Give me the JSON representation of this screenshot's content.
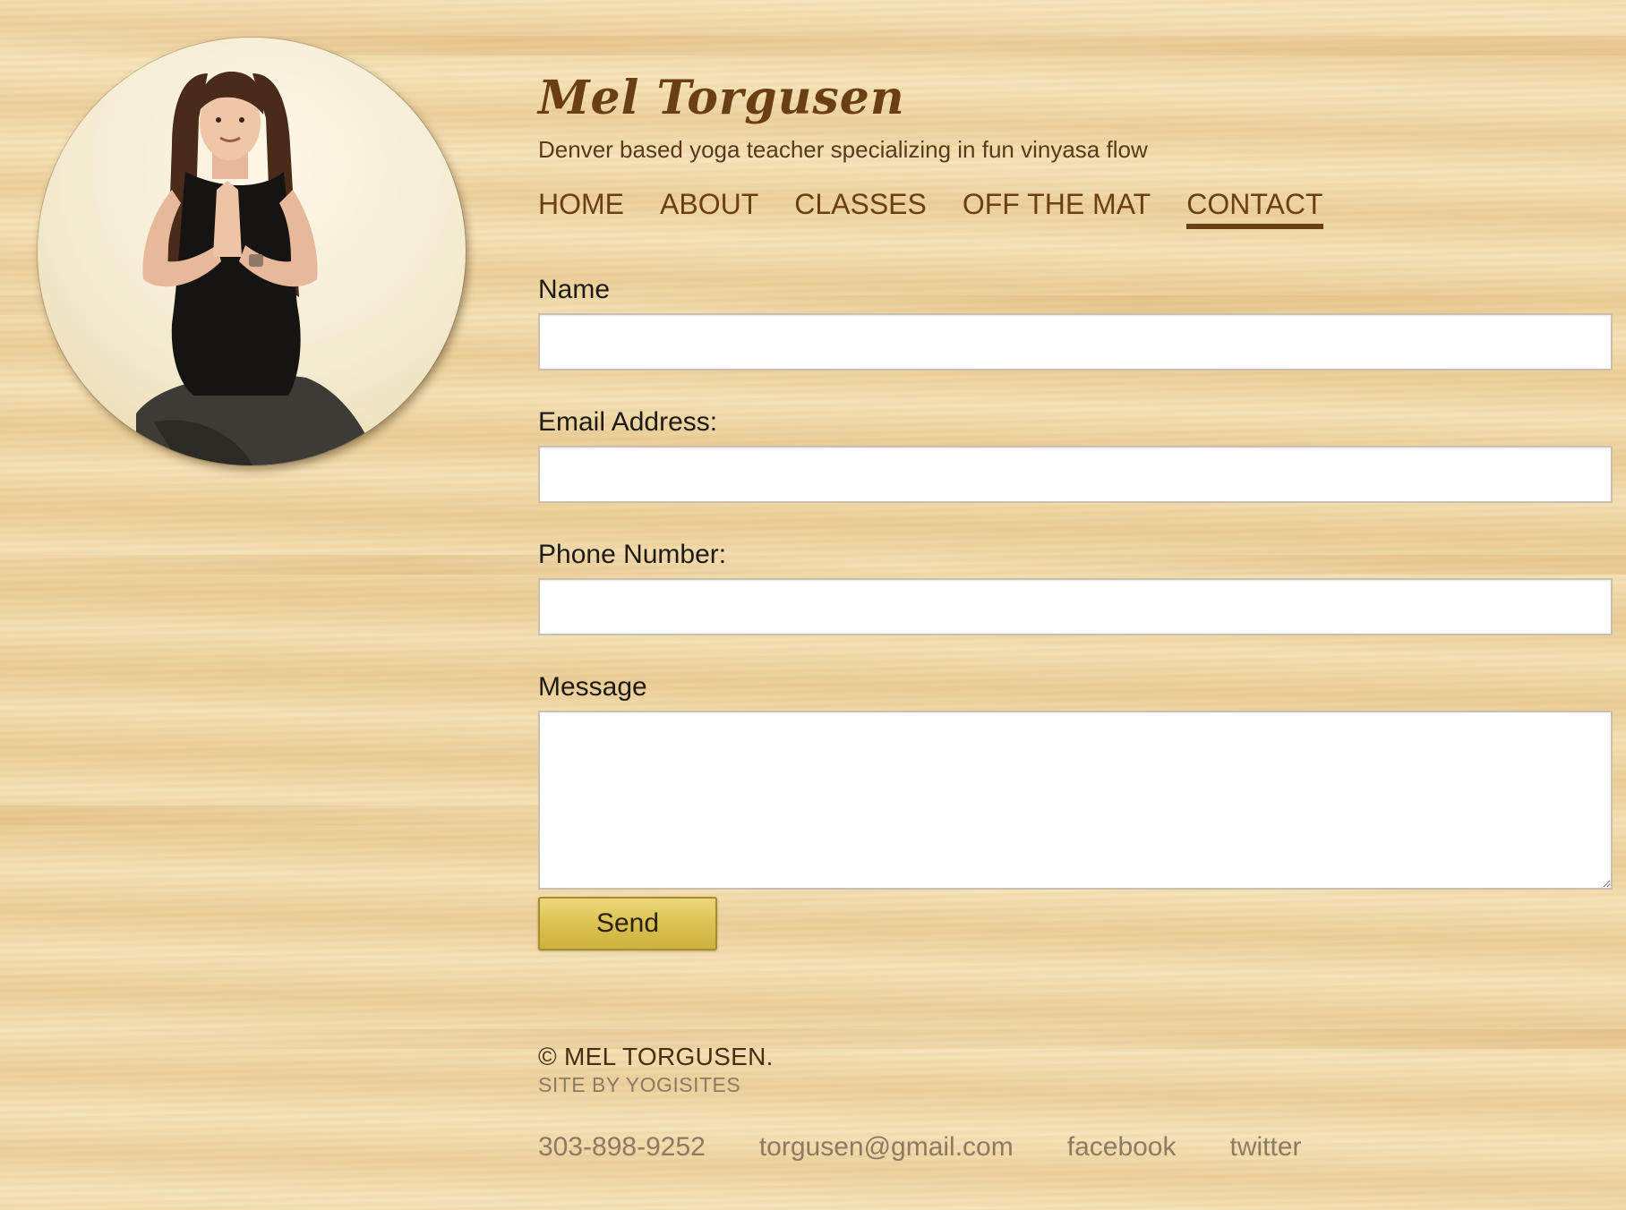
{
  "site": {
    "title": "Mel Torgusen",
    "tagline": "Denver based yoga teacher specializing in fun vinyasa flow"
  },
  "nav": {
    "items": [
      {
        "label": "HOME",
        "active": false
      },
      {
        "label": "ABOUT",
        "active": false
      },
      {
        "label": "CLASSES",
        "active": false
      },
      {
        "label": "OFF THE MAT",
        "active": false
      },
      {
        "label": "CONTACT",
        "active": true
      }
    ]
  },
  "form": {
    "name_label": "Name",
    "name_value": "",
    "email_label": "Email Address:",
    "email_value": "",
    "phone_label": "Phone Number:",
    "phone_value": "",
    "message_label": "Message",
    "message_value": "",
    "send_label": "Send"
  },
  "footer": {
    "copyright": "© MEL TORGUSEN.",
    "site_by": "SITE BY YOGISITES",
    "phone": "303-898-9252",
    "email": "torgusen@gmail.com",
    "facebook": "facebook",
    "twitter": "twitter"
  },
  "colors": {
    "brand_brown": "#6b3f14",
    "button_gold": "#d9c04f",
    "muted_text": "#8e7a63",
    "wood_background": "#f1ddb0"
  }
}
